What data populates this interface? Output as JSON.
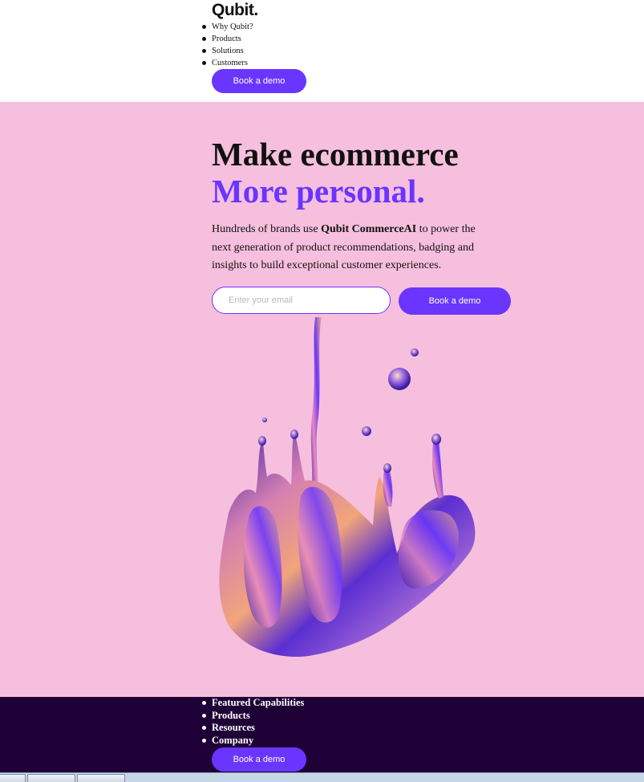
{
  "header": {
    "logo": "Qubit.",
    "nav": [
      "Why Qubit?",
      "Products",
      "Solutions",
      "Customers"
    ],
    "cta_label": "Book a demo"
  },
  "hero": {
    "headline": "Make ecommerce",
    "headline_accent": "More personal.",
    "description_prefix": "Hundreds of brands use ",
    "description_brand": "Qubit CommerceAI",
    "description_suffix": " to power the next generation of product recommendations, badging and insights to build exceptional customer experiences.",
    "email_placeholder": "Enter your email",
    "cta_label": "Book a demo",
    "art_icon": "liquid-splash-illustration"
  },
  "footer": {
    "nav": [
      "Featured Capabilities",
      "Products",
      "Resources",
      "Company"
    ],
    "cta_label": "Book a demo"
  },
  "colors": {
    "accent": "#6a35ff",
    "hero_bg": "#f6bfdd",
    "footer_bg": "#1e0037"
  }
}
